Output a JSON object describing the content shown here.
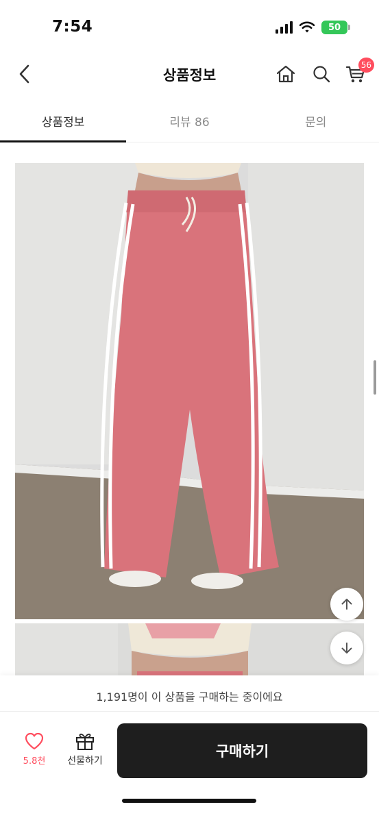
{
  "status_bar": {
    "time": "7:54",
    "battery": "50",
    "icons": [
      "cellular-signal-icon",
      "wifi-icon",
      "battery-icon"
    ]
  },
  "nav": {
    "title": "상품정보",
    "cart_count": "56",
    "icons": [
      "back-chevron-icon",
      "home-icon",
      "search-icon",
      "cart-icon"
    ]
  },
  "tabs": [
    {
      "label": "상품정보",
      "active": true
    },
    {
      "label": "리뷰 86",
      "active": false
    },
    {
      "label": "문의",
      "active": false
    }
  ],
  "product_images": [
    {
      "alt": "pink wide-leg track pants with white side stripes"
    },
    {
      "alt": "second product photo"
    }
  ],
  "floating_buttons": [
    "arrow-up-icon",
    "arrow-down-icon"
  ],
  "bottom_bar": {
    "buyer_notice": "1,191명이 이 상품을 구매하는 중이에요",
    "like_count": "5.8천",
    "gift_label": "선물하기",
    "buy_label": "구매하기"
  },
  "colors": {
    "accent": "#ff4d5e",
    "buy_button": "#1e1e1e",
    "battery": "#34c759",
    "pants_pink": "#d9737b"
  }
}
